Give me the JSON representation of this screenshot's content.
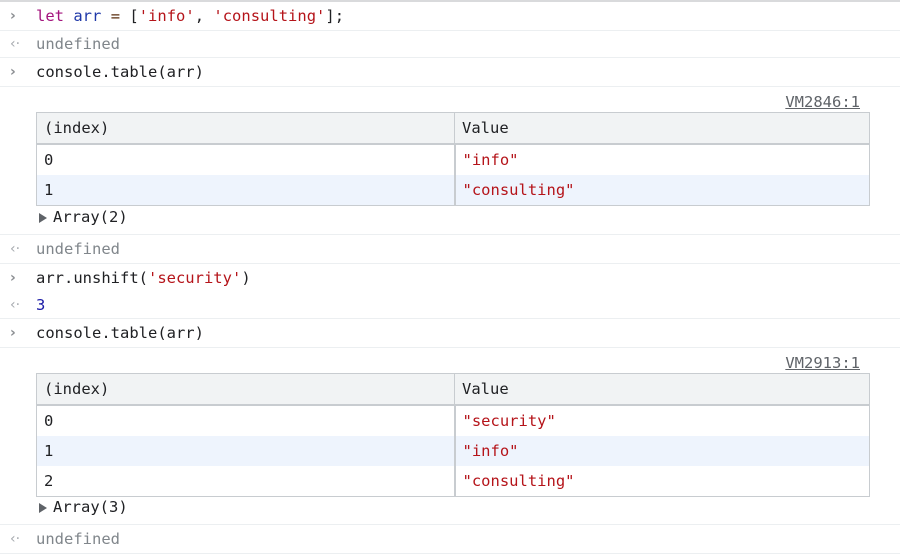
{
  "entries": [
    {
      "type": "input",
      "text": "let arr = ['info', 'consulting'];"
    },
    {
      "type": "output",
      "text": "undefined"
    },
    {
      "type": "input",
      "text": "console.table(arr)"
    }
  ],
  "table1": {
    "source_link": "VM2846:1",
    "headers": [
      "(index)",
      "Value"
    ],
    "rows": [
      [
        "0",
        "\"info\""
      ],
      [
        "1",
        "\"consulting\""
      ]
    ],
    "array_label": "Array(2)"
  },
  "after_table1": {
    "text": "undefined"
  },
  "unshift": {
    "input": "arr.unshift('security')",
    "output": "3"
  },
  "table_call": {
    "input": "console.table(arr)"
  },
  "table2": {
    "source_link": "VM2913:1",
    "headers": [
      "(index)",
      "Value"
    ],
    "rows": [
      [
        "0",
        "\"security\""
      ],
      [
        "1",
        "\"info\""
      ],
      [
        "2",
        "\"consulting\""
      ]
    ],
    "array_label": "Array(3)"
  },
  "final_output": {
    "text": "undefined"
  },
  "icons": {
    "input": "chevron-right-icon",
    "output": "return-arrow-icon"
  },
  "colors": {
    "keyword": "#a3147d",
    "variable": "#1f38a8",
    "string": "#b5141a",
    "number": "#1a1aa6",
    "undefined": "#80868b"
  }
}
